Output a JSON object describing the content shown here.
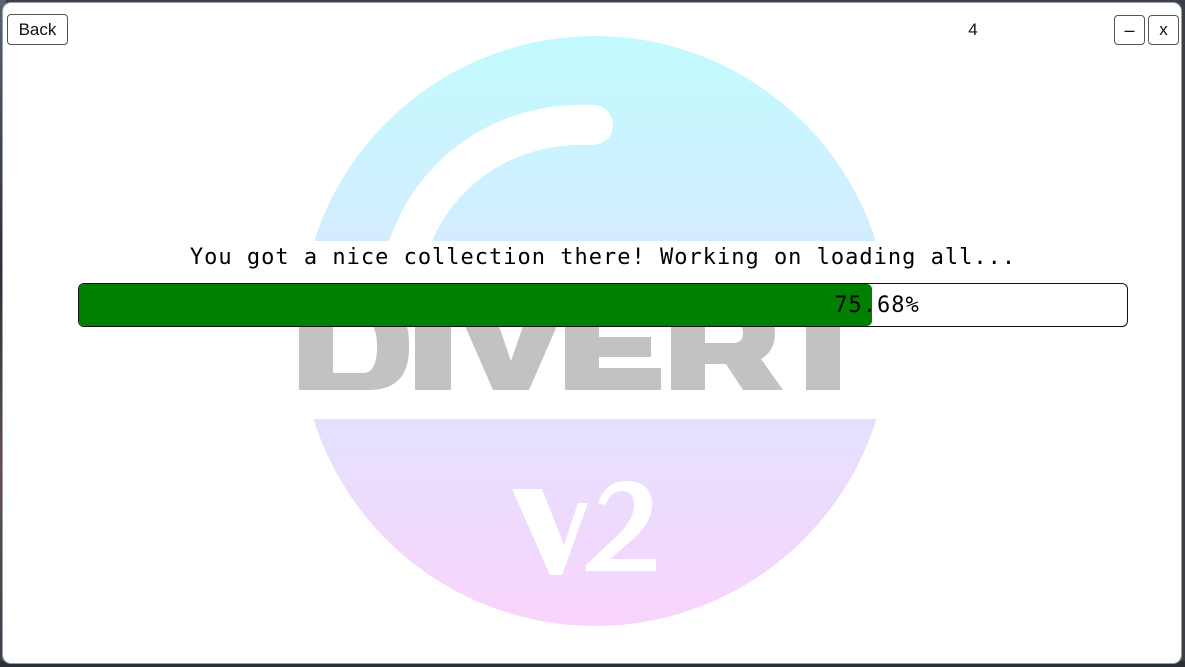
{
  "window": {
    "back_label": "Back",
    "counter": "4",
    "minimize_label": "–",
    "close_label": "x"
  },
  "loading": {
    "message": "You got a nice collection there! Working on loading all...",
    "progress_percent": 75.68,
    "progress_label": "75.68%"
  },
  "logo": {
    "name": "divert-v2-logo",
    "lettering": "DIVERT V2",
    "gradient_top": "#c2fbff",
    "gradient_bottom": "#f9d4fb",
    "letter_color": "#c2c2c2"
  },
  "colors": {
    "progress_fill": "#008000",
    "background": "#ffffff"
  }
}
